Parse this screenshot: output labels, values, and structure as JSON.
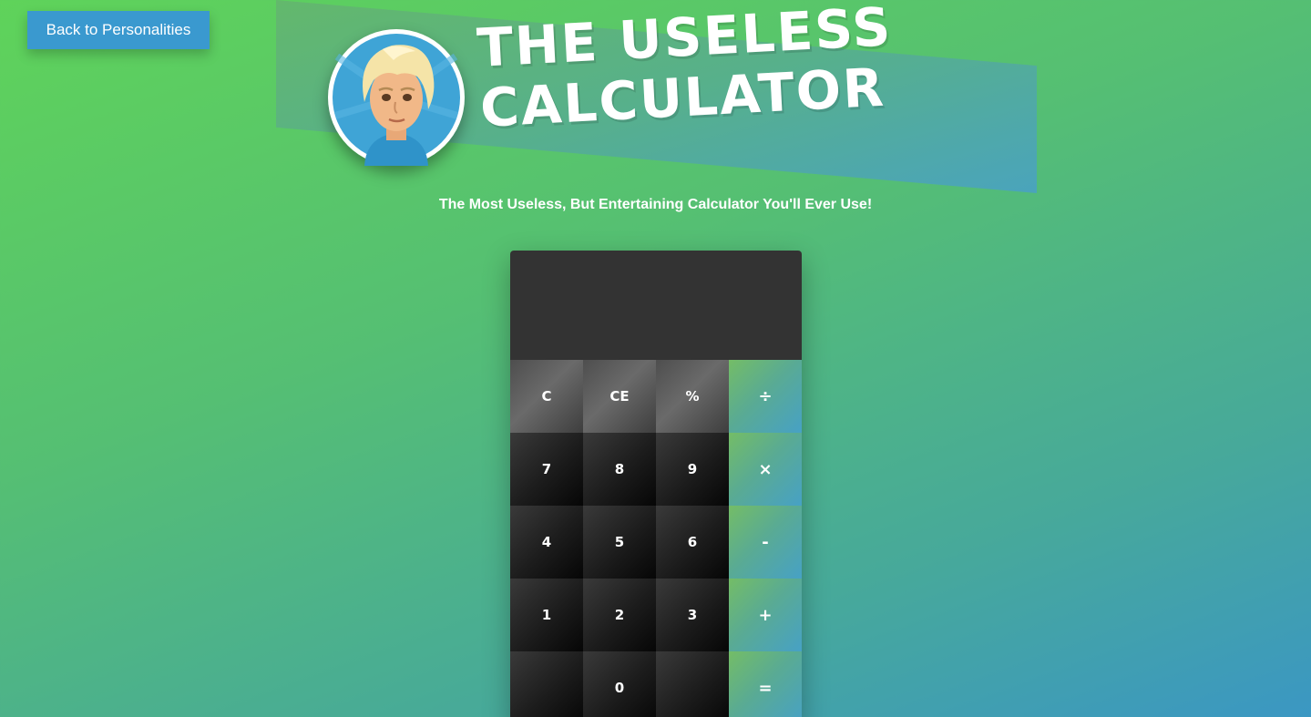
{
  "nav": {
    "back_label": "Back to Personalities"
  },
  "header": {
    "title_line1": "The Useless",
    "title_line2": "Calculator",
    "subtitle": "The Most Useless, But Entertaining Calculator You'll Ever Use!"
  },
  "calculator": {
    "display_value": "",
    "keys": {
      "clear": "C",
      "clear_entry": "CE",
      "percent": "%",
      "divide": "÷",
      "seven": "7",
      "eight": "8",
      "nine": "9",
      "multiply": "×",
      "four": "4",
      "five": "5",
      "six": "6",
      "subtract": "-",
      "one": "1",
      "two": "2",
      "three": "3",
      "add": "+",
      "blank_left": "",
      "zero": "0",
      "blank_right": "",
      "equals": "="
    }
  },
  "colors": {
    "button_blue": "#3a99cf",
    "display_bg": "#333333",
    "operator_green": "#5aab92"
  }
}
